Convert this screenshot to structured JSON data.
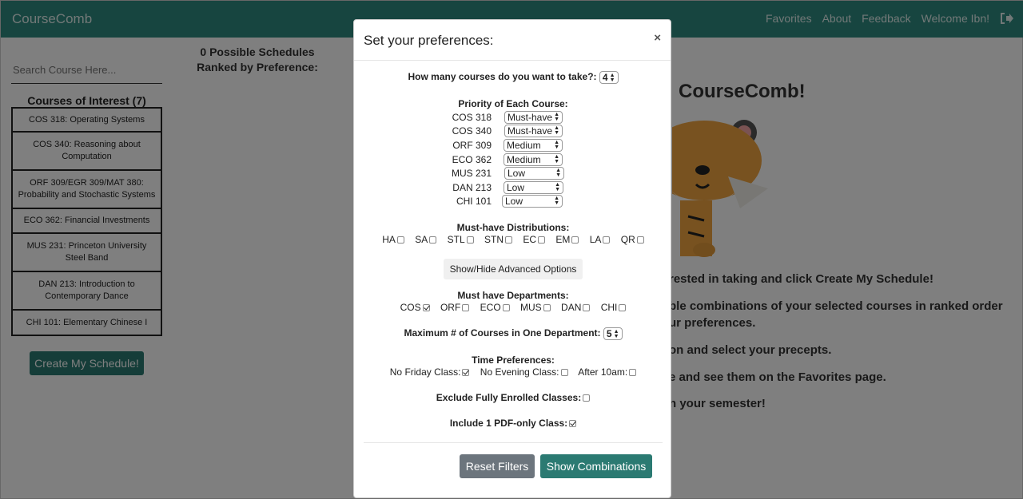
{
  "navbar": {
    "brand": "CourseComb",
    "links": [
      "Favorites",
      "About",
      "Feedback",
      "Welcome Ibn!"
    ]
  },
  "sidebar": {
    "search_placeholder": "Search Course Here...",
    "interest_title": "Courses of Interest (7)",
    "courses": [
      "COS 318: Operating Systems",
      "COS 340: Reasoning about Computation",
      "ORF 309/EGR 309/MAT 380: Probability and Stochastic Systems",
      "ECO 362: Financial Investments",
      "MUS 231: Princeton University Steel Band",
      "DAN 213: Introduction to Contemporary Dance",
      "CHI 101: Elementary Chinese I"
    ],
    "create_button": "Create My Schedule!"
  },
  "main": {
    "ranked_text": "0 Possible Schedules Ranked by Preference:",
    "welcome_partial": "CourseComb!",
    "instructions": [
      "rested in taking and click Create My Schedule!",
      "ble combinations of your selected courses in ranked order",
      "ur preferences.",
      "on and select your precepts.",
      "e and see them on the Favorites page.",
      "n your semester!"
    ]
  },
  "modal": {
    "title": "Set your preferences:",
    "close": "×",
    "num_courses_label": "How many courses do you want to take?:",
    "num_courses_value": "4",
    "priority_title": "Priority of Each Course:",
    "priorities": [
      {
        "course": "COS 318",
        "value": "Must-have"
      },
      {
        "course": "COS 340",
        "value": "Must-have"
      },
      {
        "course": "ORF 309",
        "value": "Medium"
      },
      {
        "course": "ECO 362",
        "value": "Medium"
      },
      {
        "course": "MUS 231",
        "value": "Low"
      },
      {
        "course": "DAN 213",
        "value": "Low"
      },
      {
        "course": "CHI 101",
        "value": "Low"
      }
    ],
    "distributions_title": "Must-have Distributions:",
    "distributions": [
      {
        "label": "HA",
        "checked": false
      },
      {
        "label": "SA",
        "checked": false
      },
      {
        "label": "STL",
        "checked": false
      },
      {
        "label": "STN",
        "checked": false
      },
      {
        "label": "EC",
        "checked": false
      },
      {
        "label": "EM",
        "checked": false
      },
      {
        "label": "LA",
        "checked": false
      },
      {
        "label": "QR",
        "checked": false
      }
    ],
    "advanced_button": "Show/Hide Advanced Options",
    "departments_title": "Must have Departments:",
    "departments": [
      {
        "label": "COS",
        "checked": true
      },
      {
        "label": "ORF",
        "checked": false
      },
      {
        "label": "ECO",
        "checked": false
      },
      {
        "label": "MUS",
        "checked": false
      },
      {
        "label": "DAN",
        "checked": false
      },
      {
        "label": "CHI",
        "checked": false
      }
    ],
    "max_dept_label": "Maximum # of Courses in One Department:",
    "max_dept_value": "5",
    "time_title": "Time Preferences:",
    "time_prefs": [
      {
        "label": "No Friday Class:",
        "checked": true
      },
      {
        "label": "No Evening Class:",
        "checked": false
      },
      {
        "label": "After 10am:",
        "checked": false
      }
    ],
    "exclude_label": "Exclude Fully Enrolled Classes:",
    "exclude_checked": false,
    "pdf_label": "Include 1 PDF-only Class:",
    "pdf_checked": true,
    "reset_button": "Reset Filters",
    "show_button": "Show Combinations"
  }
}
